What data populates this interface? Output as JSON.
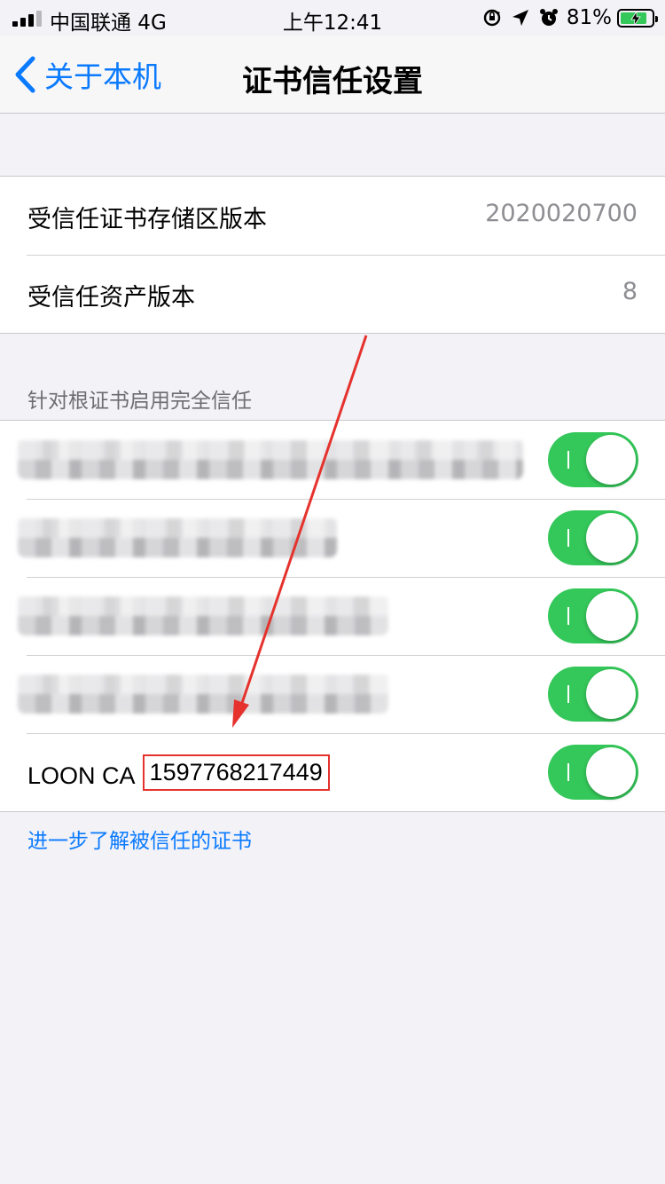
{
  "status_bar": {
    "carrier": "中国联通   4G",
    "time": "上午12:41",
    "battery": "81%"
  },
  "nav": {
    "back_label": "关于本机",
    "title": "证书信任设置"
  },
  "info_rows": [
    {
      "label": "受信任证书存储区版本",
      "value": "2020020700"
    },
    {
      "label": "受信任资产版本",
      "value": "8"
    }
  ],
  "trust_section": {
    "header": "针对根证书启用完全信任",
    "certificates": [
      {
        "name": "",
        "enabled": true,
        "redacted": true
      },
      {
        "name": "",
        "enabled": true,
        "redacted": true
      },
      {
        "name": "",
        "enabled": true,
        "redacted": true
      },
      {
        "name": "",
        "enabled": true,
        "redacted": true
      },
      {
        "name_prefix": "LOON CA ",
        "name_id": "1597768217449",
        "enabled": true,
        "redacted": false
      }
    ]
  },
  "footer_link": "进一步了解被信任的证书",
  "colors": {
    "accent": "#0a7aff",
    "toggle_on": "#34c759",
    "annotation": "#e5322d"
  }
}
